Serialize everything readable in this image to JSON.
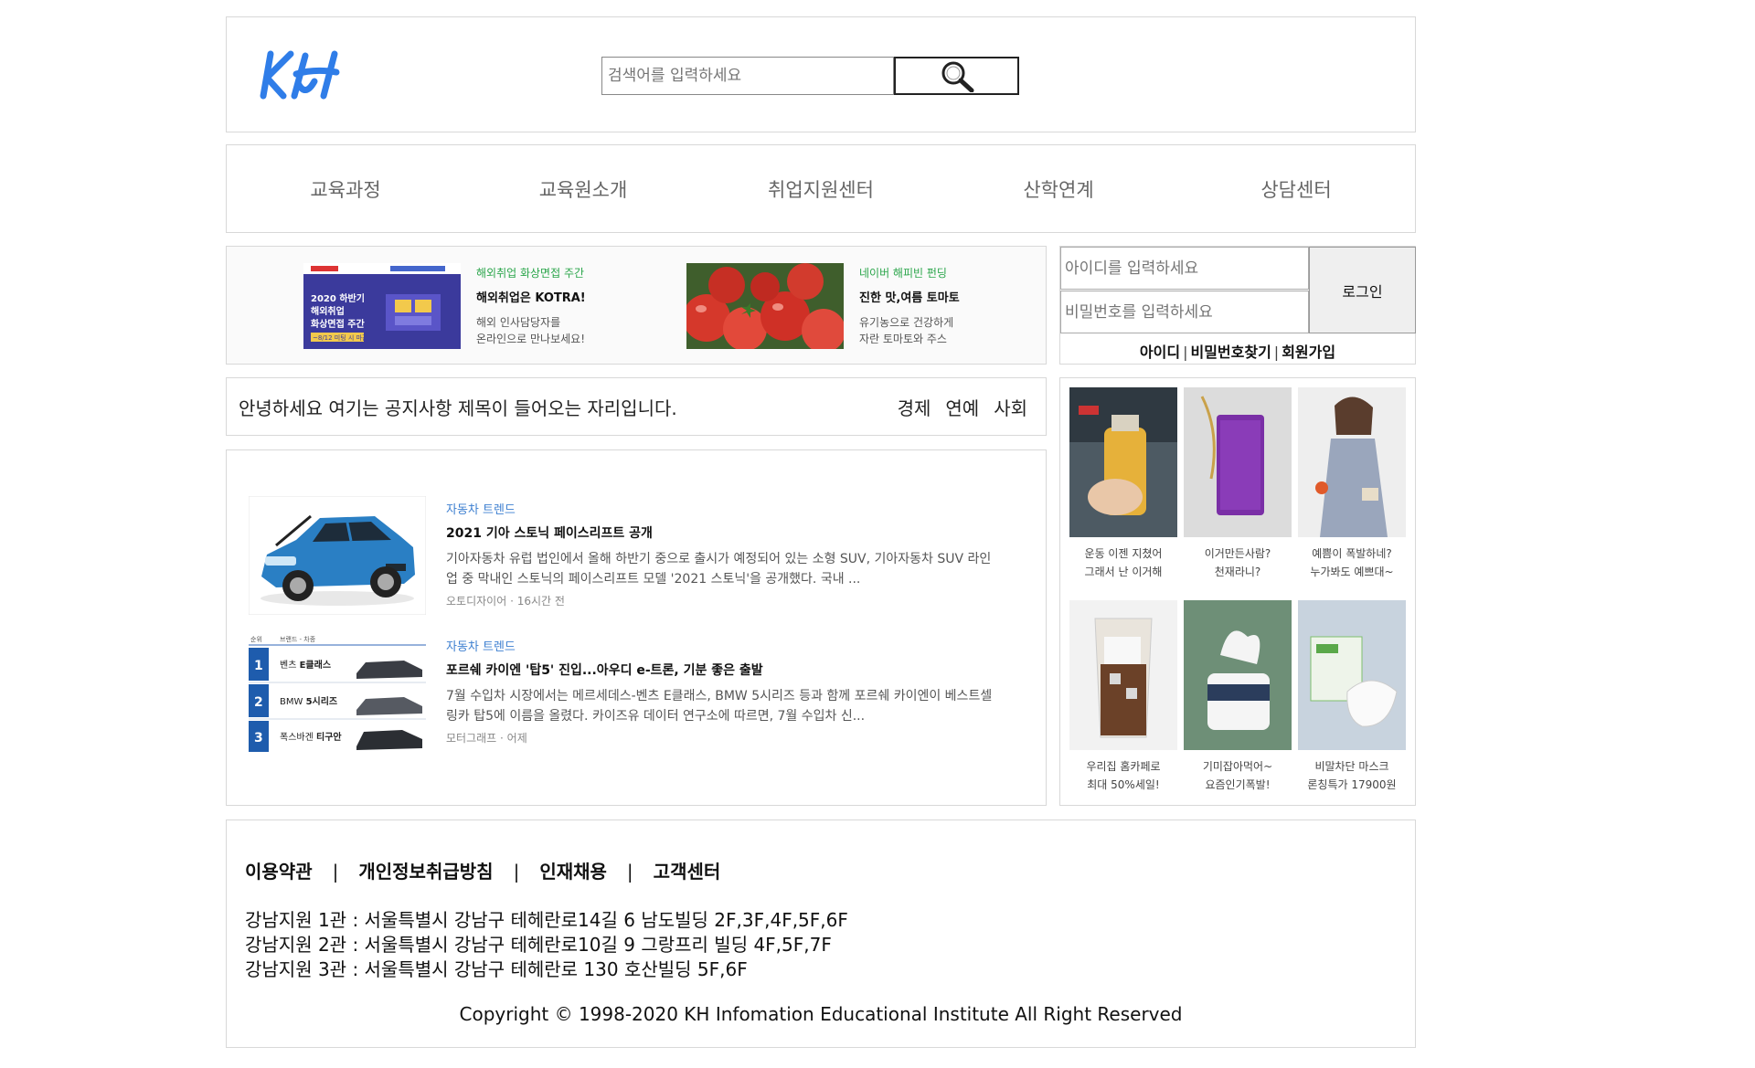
{
  "header": {
    "logo_text": "KH",
    "search_placeholder": "검색어를 입력하세요"
  },
  "nav": {
    "items": [
      "교육과정",
      "교육원소개",
      "취업지원센터",
      "산학연계",
      "상담센터"
    ]
  },
  "banners": [
    {
      "image_text": "2020 하반기 해외취업 화상면접 주간 ~8/12 미팅 시 마감",
      "tag": "해외취업 화상면접 주간",
      "title": "해외취업은 KOTRA!",
      "desc": "해외 인사담당자를\n온라인으로 만나보세요!"
    },
    {
      "tag": "네이버 해피빈 펀딩",
      "title": "진한 맛,여름 토마토",
      "desc": "유기농으로 건강하게\n자란 토마토와 주스"
    }
  ],
  "login": {
    "id_placeholder": "아이디를 입력하세요",
    "pw_placeholder": "비밀번호를 입력하세요",
    "button": "로그인",
    "links": [
      "아이디",
      "비밀번호찾기",
      "회원가입"
    ]
  },
  "notice": {
    "title": "안녕하세요 여기는 공지사항 제목이 들어오는 자리입니다.",
    "categories": [
      "경제",
      "연예",
      "사회"
    ]
  },
  "news": [
    {
      "tag": "자동차 트렌드",
      "title": "2021 기아 스토닉 페이스리프트 공개",
      "desc": "기아자동차 유럽 법인에서 올해 하반기 중으로 출시가 예정되어 있는 소형 SUV, 기아자동차 SUV 라인업 중 막내인 스토닉의 페이스리프트 모델 '2021 스토닉'을 공개했다. 국내 ...",
      "source": "오토디자이어",
      "time": "16시간 전"
    },
    {
      "tag": "자동차 트렌드",
      "title": "포르쉐 카이엔 '탑5' 진입...아우디 e-트론, 기분 좋은 출발",
      "desc": "7월 수입차 시장에서는 메르세데스-벤츠 E클래스, BMW 5시리즈 등과 함께 포르쉐 카이엔이 베스트셀링카 탑5에 이름을 올렸다. 카이즈유 데이터 연구소에 따르면, 7월 수입차 신...",
      "source": "모터그래프",
      "time": "어제",
      "ranking": {
        "header_rank": "순위",
        "header_brand": "브랜드 - 차종",
        "rows": [
          {
            "rank": "1",
            "brand": "벤츠",
            "model": "E클래스"
          },
          {
            "rank": "2",
            "brand": "BMW",
            "model": "5시리즈"
          },
          {
            "rank": "3",
            "brand": "폭스바겐",
            "model": "티구안"
          }
        ]
      }
    }
  ],
  "shop": [
    {
      "caption": "운동 이젠 지쳤어\n그래서 난 이거해"
    },
    {
      "caption": "이거만든사람?\n천재라니?"
    },
    {
      "caption": "예쁨이 폭발하네?\n누가봐도 예쁘대~"
    },
    {
      "caption": "우리집 홈카페로\n최대 50%세일!"
    },
    {
      "caption": "기미잡아먹어~\n요즘인기폭발!"
    },
    {
      "caption": "비말차단 마스크\n론칭특가 17900원"
    }
  ],
  "footer": {
    "links": [
      "이용약관",
      "개인정보취급방침",
      "인재채용",
      "고객센터"
    ],
    "separator": "|",
    "addresses": [
      "강남지원 1관 : 서울특별시 강남구 테헤란로14길 6 남도빌딩 2F,3F,4F,5F,6F",
      "강남지원 2관 : 서울특별시 강남구 테헤란로10길 9 그랑프리 빌딩 4F,5F,7F",
      "강남지원 3관 : 서울특별시 강남구 테헤란로 130 호산빌딩 5F,6F"
    ],
    "copyright": "Copyright © 1998-2020 KH Infomation Educational Institute All Right Reserved"
  },
  "colors": {
    "border": "#d8d8d8",
    "logo_blue": "#2f7de8",
    "banner_tag_green": "#2aa54a",
    "news_tag_blue": "#3d7fd0"
  }
}
